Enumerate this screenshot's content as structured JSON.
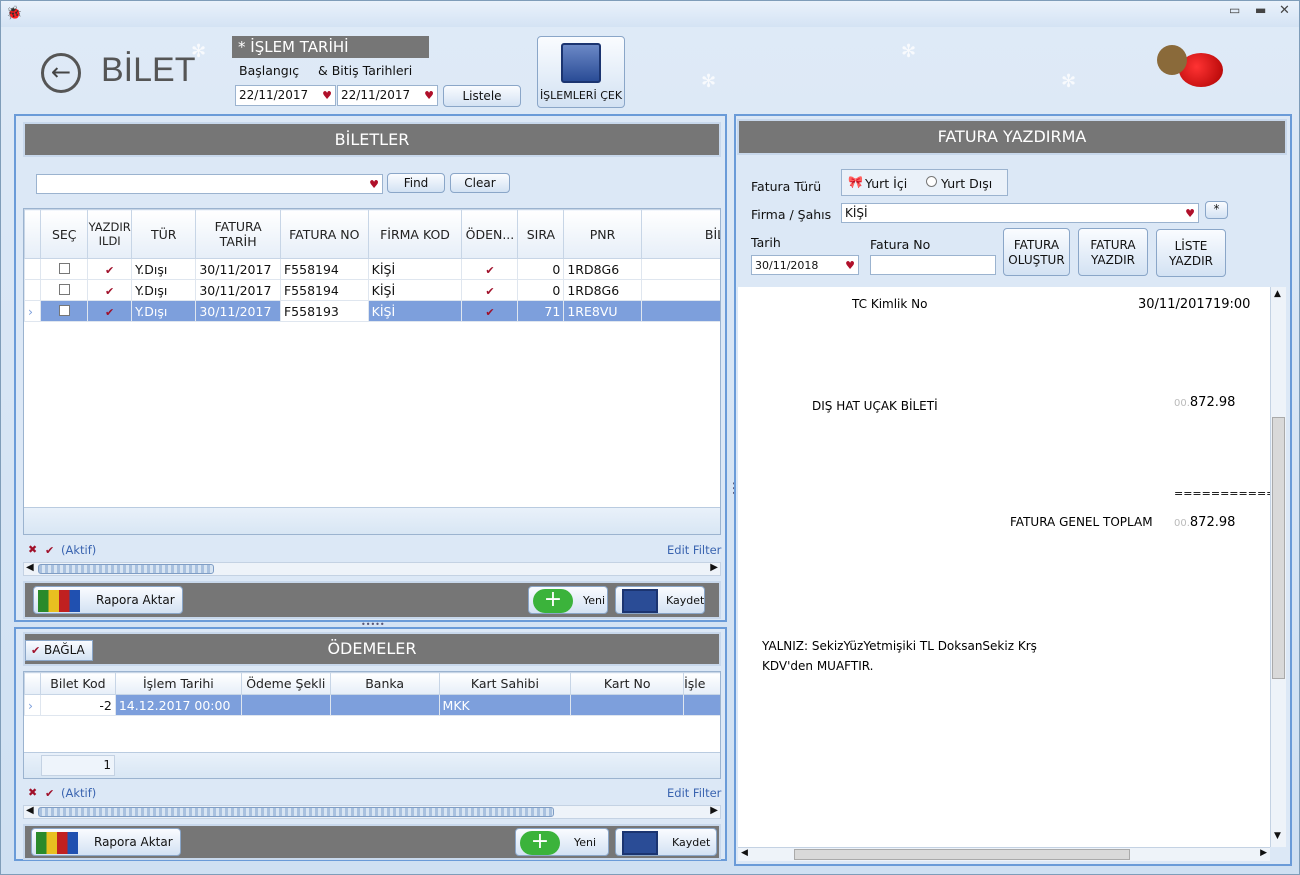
{
  "window": {
    "title": "BİLET"
  },
  "header": {
    "title": "BİLET",
    "islem_tarihi_label": "* İŞLEM TARİHİ",
    "baslangic_label": "Başlangıç",
    "bitis_label": "&  Bitiş Tarihleri",
    "start_date": "22/11/2017",
    "end_date": "22/11/2017",
    "listele_label": "Listele",
    "islemleri_cek_label": "İŞLEMLERİ ÇEK"
  },
  "biletler": {
    "title": "BİLETLER",
    "find_label": "Find",
    "clear_label": "Clear",
    "columns": [
      "SEÇ",
      "YAZDIR ILDI",
      "TÜR",
      "FATURA TARİH",
      "FATURA NO",
      "FİRMA KOD",
      "ÖDEN...",
      "SIRA",
      "PNR",
      "BİLET N"
    ],
    "rows": [
      {
        "tur": "Y.Dışı",
        "tarih": "30/11/2017",
        "no": "F558194",
        "firma": "KİŞİ",
        "sira": "0",
        "pnr": "1RD8G6"
      },
      {
        "tur": "Y.Dışı",
        "tarih": "30/11/2017",
        "no": "F558194",
        "firma": "KİŞİ",
        "sira": "0",
        "pnr": "1RD8G6"
      },
      {
        "tur": "Y.Dışı",
        "tarih": "30/11/2017",
        "no": "F558193",
        "firma": "KİŞİ",
        "sira": "71",
        "pnr": "1RE8VU"
      }
    ],
    "filter_text": "(Aktif)",
    "edit_filter": "Edit Filter",
    "rapora_aktar": "Rapora Aktar",
    "yeni": "Yeni",
    "kaydet": "Kaydet"
  },
  "odemeler": {
    "title": "ÖDEMELER",
    "bagla": "BAĞLA",
    "columns": [
      "Bilet Kod",
      "İşlem Tarihi",
      "Ödeme Şekli",
      "Banka",
      "Kart Sahibi",
      "Kart No",
      "İşle"
    ],
    "row": {
      "bilet_kod": "-2",
      "islem_tarihi": "14.12.2017 00:00",
      "kart_sahibi": "MKK"
    },
    "footer_count": "1",
    "filter_text": "(Aktif)",
    "edit_filter": "Edit Filter",
    "rapora_aktar": "Rapora Aktar",
    "yeni": "Yeni",
    "kaydet": "Kaydet"
  },
  "fatura": {
    "title": "FATURA YAZDIRMA",
    "fatura_turu_label": "Fatura Türü",
    "yurt_ici": "Yurt İçi",
    "yurt_disi": "Yurt Dışı",
    "firma_label": "Firma / Şahıs",
    "firma_value": "KİŞİ",
    "tarih_label": "Tarih",
    "tarih_value": "30/11/2018",
    "fatura_no_label": "Fatura No",
    "olustur": "FATURA OLUŞTUR",
    "yazdir": "FATURA YAZDIR",
    "liste_yazdir": "LİSTE YAZDIR"
  },
  "preview": {
    "tc_kimlik": "TC Kimlik No",
    "date": "30/11/2017",
    "time": "19:00",
    "line_item": "DIŞ HAT UÇAK BİLETİ",
    "currency": "00.",
    "amount": "872.98",
    "separator": "===========",
    "total_label": "FATURA GENEL TOPLAM",
    "total_amount": "872.98",
    "yalniz": "YALNIZ: SekizYüzYetmişiki TL DoksanSekiz Krş",
    "kdv": "KDV'den MUAFTIR."
  }
}
